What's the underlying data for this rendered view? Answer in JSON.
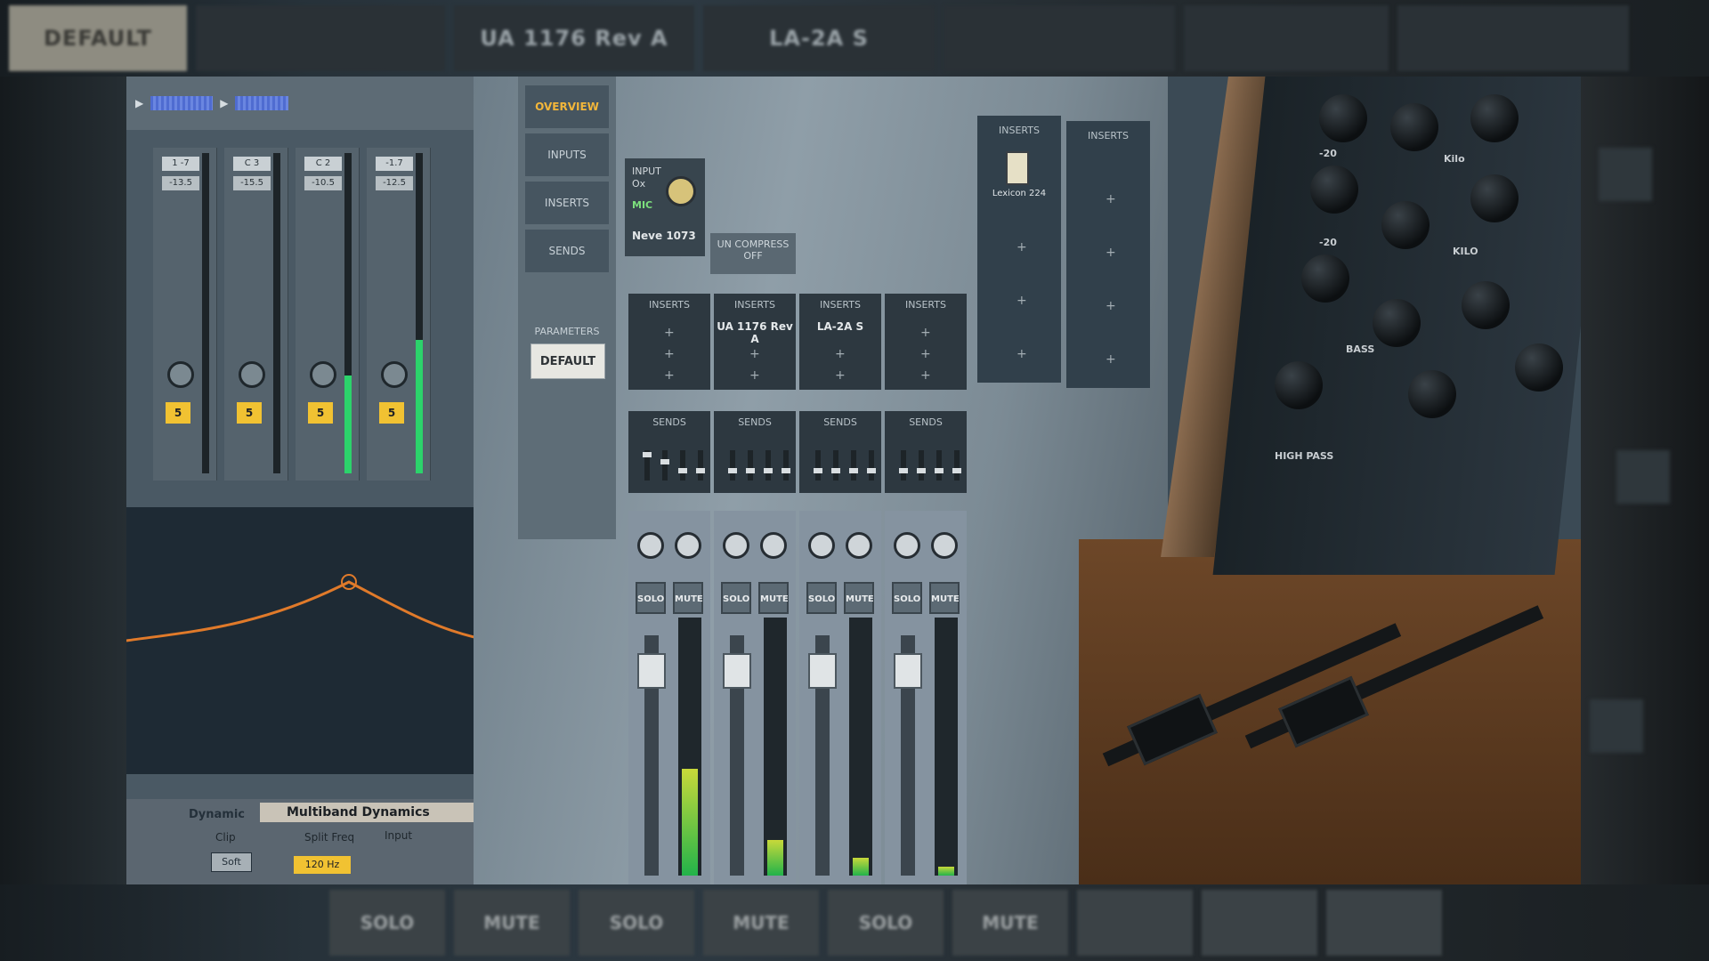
{
  "top_strip": {
    "default_label": "DEFAULT",
    "insert_1176": "UA 1176 Rev A",
    "insert_la2a": "LA-2A S"
  },
  "bottom_strip": {
    "labels": [
      "SOLO",
      "MUTE",
      "SOLO",
      "MUTE",
      "SOLO",
      "MUTE"
    ]
  },
  "daw": {
    "channels": [
      {
        "name": "1 -7",
        "value": "-13.5",
        "track": "5"
      },
      {
        "name": "C 3",
        "value": "-15.5",
        "track": "5"
      },
      {
        "name": "C 2",
        "value": "-10.5",
        "track": "5"
      },
      {
        "name": "-1.7",
        "value": "-12.5",
        "track": "5"
      }
    ],
    "device": {
      "name": "Dynamic",
      "title": "Multiband Dynamics",
      "split_freq_label": "Split Freq",
      "input_label": "Input",
      "clip_label": "Clip",
      "clip_btn": "Soft",
      "split_value": "120 Hz"
    }
  },
  "console": {
    "nav": {
      "overview": "OVERVIEW",
      "inputs": "INPUTS",
      "inserts": "INSERTS",
      "sends": "SENDS",
      "parameters": "PARAMETERS",
      "default_button": "DEFAULT"
    },
    "unison": {
      "label": "INPUT",
      "level": "Ox",
      "mic": "MIC",
      "preamp": "Neve 1073"
    },
    "uncomp": {
      "line1": "UN COMPRESS",
      "line2": "OFF"
    },
    "inserts_header": "INSERTS",
    "sends_header": "SENDS",
    "insert_slots": [
      "",
      "UA 1176 Rev A",
      "LA-2A S",
      ""
    ],
    "right_inserts": [
      {
        "header": "INSERTS",
        "plugin": "Lexicon 224"
      },
      {
        "header": "INSERTS",
        "plugin": ""
      }
    ],
    "solo_label": "SOLO",
    "mute_label": "MUTE"
  },
  "hardware": {
    "labels": [
      "-20",
      "Kilo",
      "-20",
      "KILO",
      "BASS",
      "HIGH PASS"
    ],
    "knob_count": 12
  },
  "colors": {
    "accent": "#f2b63a",
    "meter_green": "#2cd36b",
    "track_yellow": "#f1c232",
    "eq_curve": "#e07a2a"
  }
}
